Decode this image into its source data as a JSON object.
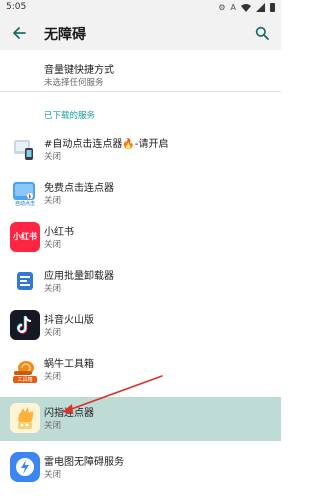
{
  "status_bar": {
    "time": "5:05",
    "icons": [
      "gear-icon",
      "a-icon",
      "wifi-icon",
      "signal-icon",
      "battery-icon"
    ]
  },
  "app_bar": {
    "title": "无障碍",
    "back_icon": "back-arrow-icon",
    "search_icon": "search-icon"
  },
  "volume_key": {
    "title": "音量键快捷方式",
    "subtitle": "未选择任何服务"
  },
  "section_header": "已下载的服务",
  "services": [
    {
      "title": "#自动点击连点器🔥-请开启",
      "subtitle": "关闭",
      "icon": "auto-clicker-icon"
    },
    {
      "title": "免费点击连点器",
      "subtitle": "关闭",
      "icon": "free-clicker-icon",
      "icon_caption": "自动点击"
    },
    {
      "title": "小红书",
      "subtitle": "关闭",
      "icon": "xiaohongshu-icon",
      "icon_caption": "小红书"
    },
    {
      "title": "应用批量卸载器",
      "subtitle": "关闭",
      "icon": "batch-uninstaller-icon"
    },
    {
      "title": "抖音火山版",
      "subtitle": "关闭",
      "icon": "douyin-huoshan-icon"
    },
    {
      "title": "蜗牛工具箱",
      "subtitle": "关闭",
      "icon": "snail-toolbox-icon",
      "icon_caption": "工具箱"
    },
    {
      "title": "闪指连点器",
      "subtitle": "关闭",
      "icon": "flash-clicker-icon",
      "selected": true
    },
    {
      "title": "雷电图无障碍服务",
      "subtitle": "关闭",
      "icon": "leidiantu-icon"
    }
  ],
  "colors": {
    "accent": "#1aa0a0",
    "selected_row": "#bfdbd5",
    "annotation_arrow": "#d9342b",
    "app_bar": "#f2f2f2"
  }
}
